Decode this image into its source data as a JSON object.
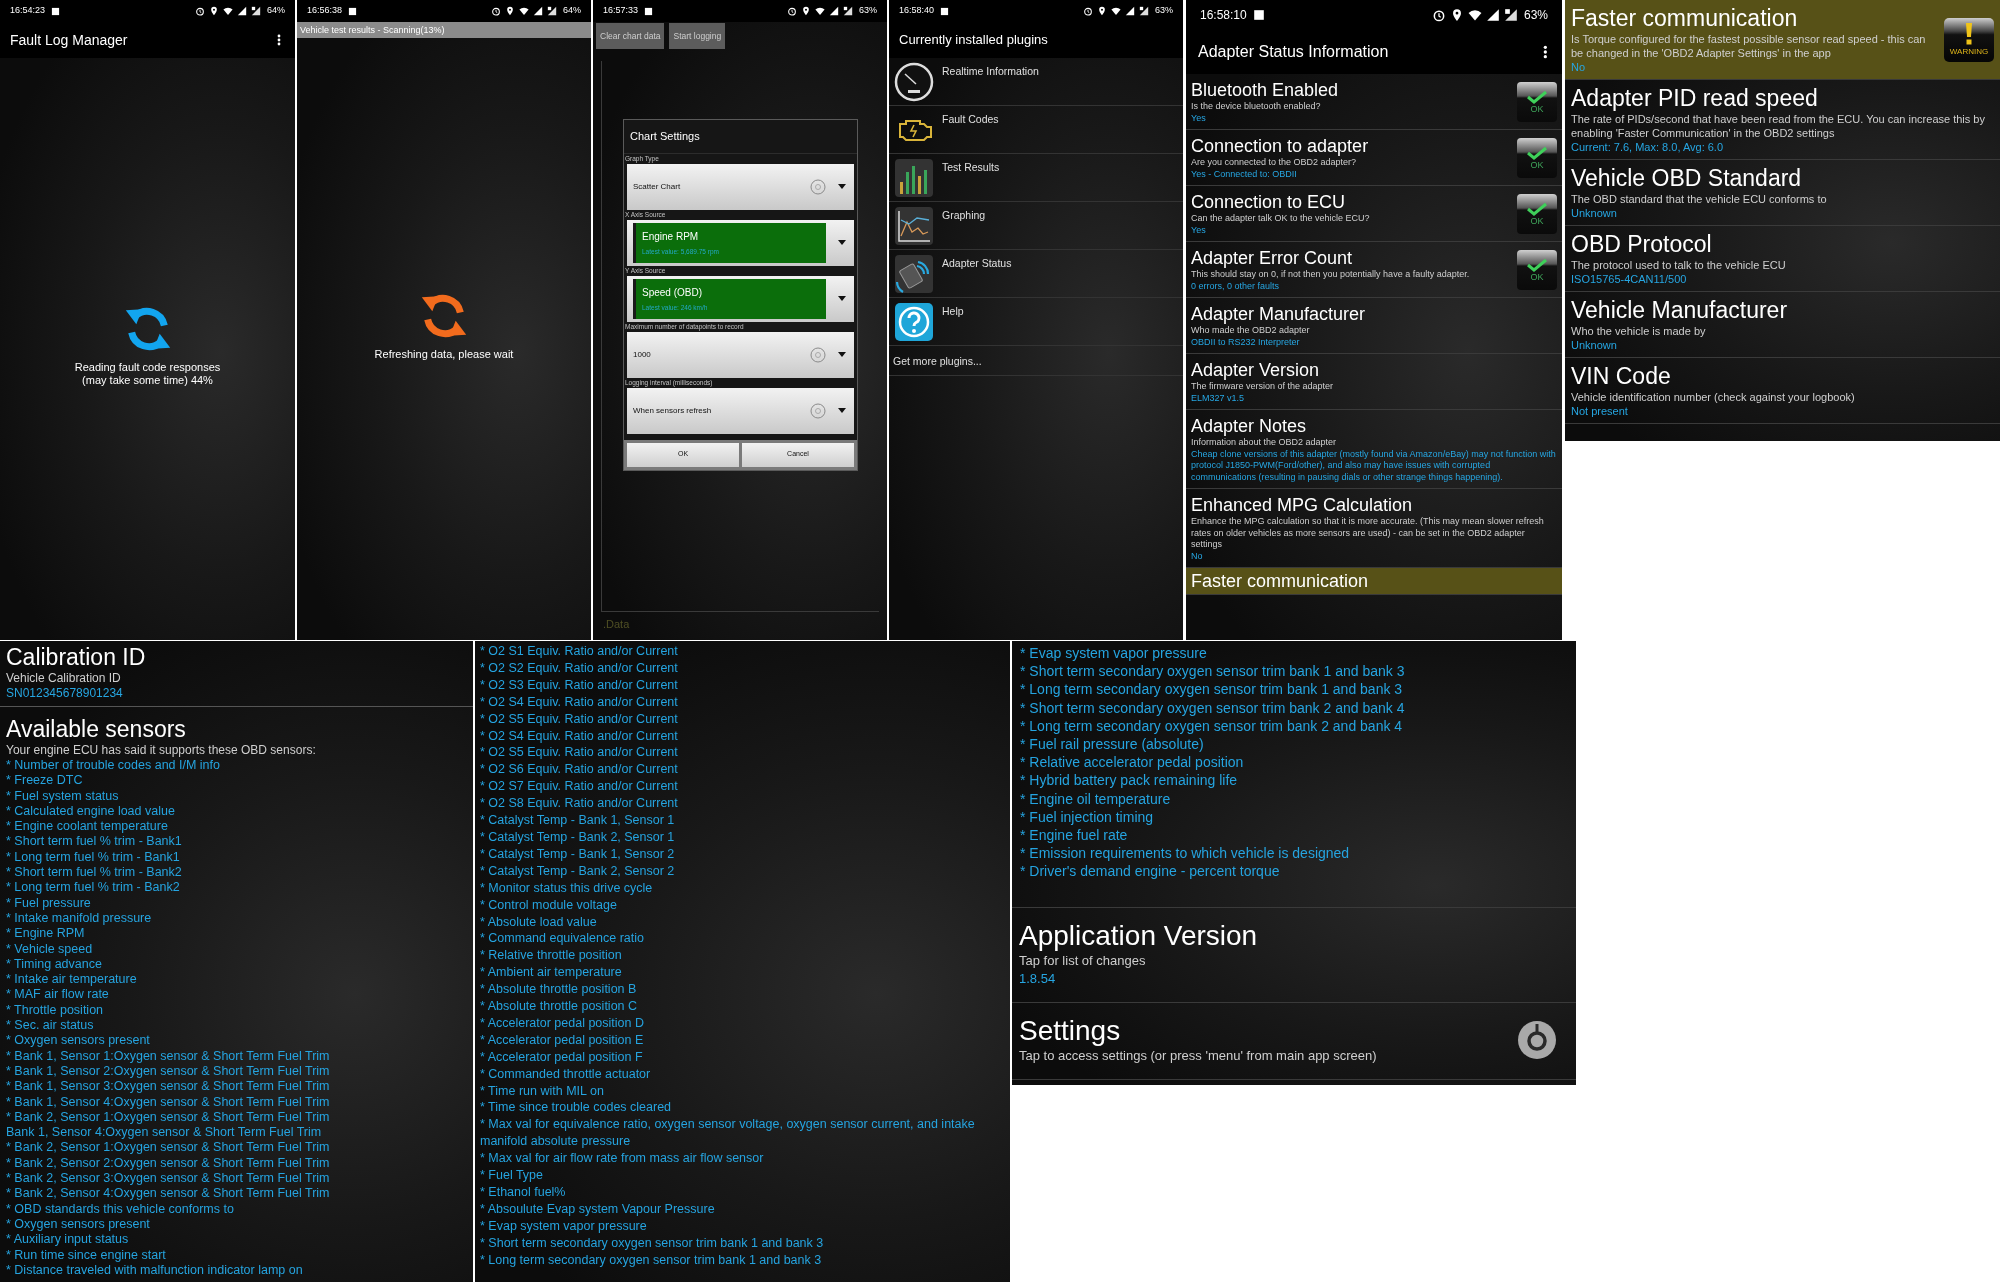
{
  "fault_log_screen": {
    "status_bar": {
      "time": "16:54:23",
      "battery": "64%"
    },
    "app_bar": {
      "title": "Fault Log Manager"
    },
    "spinner": {
      "color": "#12a5ef"
    },
    "message_lines": [
      "Reading fault code responses",
      "(may take some time) 44%"
    ]
  },
  "scan_screen": {
    "status_bar": {
      "time": "16:56:38",
      "battery": "64%"
    },
    "header_strip": "Vehicle test results - Scanning(13%)",
    "spinner": {
      "color": "#f26b1d"
    },
    "message_lines": [
      "Refreshing data, please wait"
    ]
  },
  "chart_screen": {
    "status_bar": {
      "time": "16:57:33",
      "battery": "63%"
    },
    "toolbar_buttons": [
      "Clear chart data",
      "Start logging"
    ],
    "dialog": {
      "title": "Chart Settings",
      "fields": [
        {
          "label": "Graph Type",
          "kind": "choice",
          "value": "Scatter Chart"
        },
        {
          "label": "X Axis Source",
          "kind": "sensor",
          "value": "Engine RPM",
          "detail": "Latest value: 5,689.75 rpm"
        },
        {
          "label": "Y Axis Source",
          "kind": "sensor",
          "value": "Speed (OBD)",
          "detail": "Latest value: 246 km/h"
        },
        {
          "label": "Maximum number of datapoints to record",
          "kind": "choice",
          "value": "1000"
        },
        {
          "label": "Logging interval (milliseconds)",
          "kind": "choice",
          "value": "When sensors refresh"
        }
      ],
      "buttons": [
        "OK",
        "Cancel"
      ]
    },
    "footer": ".Data"
  },
  "plugins_screen": {
    "status_bar": {
      "time": "16:58:40",
      "battery": "63%"
    },
    "title": "Currently installed plugins",
    "plugins": [
      {
        "label": "Realtime Information",
        "kind": "gauge"
      },
      {
        "label": "Fault Codes",
        "kind": "engine"
      },
      {
        "label": "Test Results",
        "kind": "bars"
      },
      {
        "label": "Graphing",
        "kind": "graph"
      },
      {
        "label": "Adapter Status",
        "kind": "adapter"
      },
      {
        "label": "Help",
        "kind": "help"
      }
    ],
    "footer": "Get more plugins..."
  },
  "adapter_status_screen": {
    "status_bar": {
      "time": "16:58:10",
      "battery": "63%"
    },
    "title": "Adapter Status Information",
    "items": [
      {
        "title": "Bluetooth Enabled",
        "description": "Is the device bluetooth enabled?",
        "value": "Yes",
        "highlighted": false,
        "badge": {
          "kind": "ok",
          "label": "OK"
        }
      },
      {
        "title": "Connection to adapter",
        "description": "Are you connected to the OBD2 adapter?",
        "value": "Yes - Connected to: OBDII",
        "highlighted": false,
        "badge": {
          "kind": "ok",
          "label": "OK"
        }
      },
      {
        "title": "Connection to ECU",
        "description": "Can the adapter talk OK to the vehicle ECU?",
        "value": "Yes",
        "highlighted": false,
        "badge": {
          "kind": "ok",
          "label": "OK"
        }
      },
      {
        "title": "Adapter Error Count",
        "description": "This should stay on 0, if not then you potentially have a faulty adapter.",
        "value": "0 errors, 0 other faults",
        "highlighted": false,
        "badge": {
          "kind": "ok",
          "label": "OK"
        }
      },
      {
        "title": "Adapter Manufacturer",
        "description": "Who made the OBD2 adapter",
        "value": "OBDII to RS232 Interpreter",
        "highlighted": false
      },
      {
        "title": "Adapter Version",
        "description": "The firmware version of the adapter",
        "value": "ELM327 v1.5",
        "highlighted": false
      },
      {
        "title": "Adapter Notes",
        "description": "Information about the OBD2 adapter",
        "value": "Cheap clone versions of this adapter (mostly found via Amazon/eBay) may not function with protocol J1850-PWM(Ford/other), and also may have issues with corrupted communications (resulting in pausing dials or other strange things happening).",
        "highlighted": false
      },
      {
        "title": "Enhanced MPG Calculation",
        "description": "Enhance the MPG calculation so that it is more accurate. (This may mean slower refresh rates on older vehicles as more sensors are used) - can be set in the OBD2 adapter settings",
        "value": "No",
        "highlighted": false
      },
      {
        "title": "Faster communication",
        "highlighted": true
      }
    ]
  },
  "adapter_status_screen_continued": {
    "items": [
      {
        "title": "Faster communication",
        "description": "Is Torque configured for the fastest possible sensor read speed - this can be changed in the 'OBD2 Adapter Settings' in the app",
        "value": "No",
        "highlighted": true,
        "badge": {
          "kind": "warning",
          "label": "WARNING"
        }
      },
      {
        "title": "Adapter PID read speed",
        "description": "The rate of PIDs/second that have been read from the ECU. You can increase this by enabling 'Faster Communication' in the OBD2 settings",
        "value": "Current: 7.6, Max: 8.0, Avg: 6.0",
        "highlighted": false
      },
      {
        "title": "Vehicle OBD Standard",
        "description": "The OBD standard that the vehicle ECU conforms to",
        "value": "Unknown",
        "highlighted": false
      },
      {
        "title": "OBD Protocol",
        "description": "The protocol used to talk to the vehicle ECU",
        "value": "ISO15765-4CAN11/500",
        "highlighted": false
      },
      {
        "title": "Vehicle Manufacturer",
        "description": "Who the vehicle is made by",
        "value": "Unknown",
        "highlighted": false
      },
      {
        "title": "VIN Code",
        "description": "Vehicle identification number (check against your logbook)",
        "value": "Not present",
        "highlighted": false
      }
    ]
  },
  "sensors_screen": {
    "calibration": {
      "title": "Calibration ID",
      "description": "Vehicle Calibration ID",
      "value": "SN012345678901234"
    },
    "title": "Available sensors",
    "intro": "Your engine ECU has said it supports these OBD sensors:",
    "sensors": [
      "* Number of trouble codes and I/M info",
      "* Freeze DTC",
      "* Fuel system status",
      "* Calculated engine load value",
      "* Engine coolant temperature",
      "* Short term fuel % trim - Bank1",
      "* Long term fuel % trim - Bank1",
      "* Short term fuel % trim - Bank2",
      "* Long term fuel % trim - Bank2",
      "* Fuel pressure",
      "* Intake manifold pressure",
      "* Engine RPM",
      "* Vehicle speed",
      "* Timing advance",
      "* Intake air temperature",
      "* MAF air flow rate",
      "* Throttle position",
      "* Sec. air status",
      "* Oxygen sensors present",
      "* Bank 1, Sensor 1:Oxygen sensor & Short Term Fuel Trim",
      "* Bank 1, Sensor 2:Oxygen sensor & Short Term Fuel Trim",
      "* Bank 1, Sensor 3:Oxygen sensor & Short Term Fuel Trim",
      "* Bank 1, Sensor 4:Oxygen sensor & Short Term Fuel Trim",
      "* Bank 2, Sensor 1:Oxygen sensor & Short Term Fuel Trim",
      "Bank 1, Sensor 4:Oxygen sensor & Short Term Fuel Trim",
      "* Bank 2, Sensor 1:Oxygen sensor & Short Term Fuel Trim",
      "* Bank 2, Sensor 2:Oxygen sensor & Short Term Fuel Trim",
      "* Bank 2, Sensor 3:Oxygen sensor & Short Term Fuel Trim",
      "* Bank 2, Sensor 4:Oxygen sensor & Short Term Fuel Trim",
      "* OBD standards this vehicle conforms to",
      "* Oxygen sensors present",
      "* Auxiliary input status",
      "* Run time since engine start",
      "* Distance traveled with malfunction indicator lamp on"
    ]
  },
  "sensors_screen_continued": {
    "sensors": [
      "* O2 S1 Equiv. Ratio and/or Current",
      "* O2 S2 Equiv. Ratio and/or Current",
      "* O2 S3 Equiv. Ratio and/or Current",
      "* O2 S4 Equiv. Ratio and/or Current",
      "* O2 S5 Equiv. Ratio and/or Current",
      "* O2 S4 Equiv. Ratio and/or Current",
      "* O2 S5 Equiv. Ratio and/or Current",
      "* O2 S6 Equiv. Ratio and/or Current",
      "* O2 S7 Equiv. Ratio and/or Current",
      "* O2 S8 Equiv. Ratio and/or Current",
      "* Catalyst Temp - Bank 1, Sensor 1",
      "* Catalyst Temp - Bank 2, Sensor 1",
      "* Catalyst Temp - Bank 1, Sensor 2",
      "* Catalyst Temp - Bank 2, Sensor 2",
      "* Monitor status this drive cycle",
      "* Control module voltage",
      "* Absolute load value",
      "* Command equivalence ratio",
      "* Relative throttle position",
      "* Ambient air temperature",
      "* Absolute throttle position B",
      "* Absolute throttle position C",
      "* Accelerator pedal position D",
      "* Accelerator pedal position E",
      "* Accelerator pedal position F",
      "* Commanded throttle actuator",
      "* Time run with MIL on",
      "* Time since trouble codes cleared",
      "* Max val for equivalence ratio, oxygen sensor voltage, oxygen sensor current, and intake manifold absolute pressure",
      "* Max val for air flow rate from mass air flow sensor",
      "* Fuel Type",
      "* Ethanol fuel%",
      "* Absoulute Evap system Vapour Pressure",
      "* Evap system vapor pressure",
      "* Short term secondary oxygen sensor trim bank 1 and bank 3",
      "* Long term secondary oxygen sensor trim bank 1 and bank 3"
    ]
  },
  "app_info_screen": {
    "sensors": [
      "* Evap system vapor pressure",
      "* Short term secondary oxygen sensor trim bank 1 and bank 3",
      "* Long term secondary oxygen sensor trim bank 1 and bank 3",
      "* Short term secondary oxygen sensor trim bank 2 and bank 4",
      "* Long term secondary oxygen sensor trim bank 2 and bank 4",
      "* Fuel rail pressure (absolute)",
      "* Relative accelerator pedal position",
      "* Hybrid battery pack remaining life",
      "* Engine oil temperature",
      "* Fuel injection timing",
      "* Engine fuel rate",
      "* Emission requirements to which vehicle is designed",
      "* Driver's demand engine - percent torque"
    ],
    "sections": [
      {
        "title": "Application Version",
        "description": "Tap for list of changes",
        "value": "1.8.54"
      },
      {
        "title": "Settings",
        "description": "Tap to access settings (or press 'menu' from main app screen)",
        "kind": "settings"
      }
    ]
  }
}
